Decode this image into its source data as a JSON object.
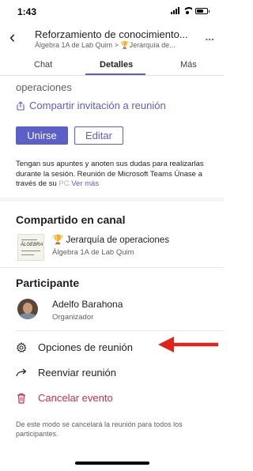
{
  "status_bar": {
    "time": "1:43"
  },
  "header": {
    "title": "Reforzamiento de conocimiento...",
    "subtitle_course": "Álgebra 1A de Lab Quim",
    "subtitle_sep": " > ",
    "subtitle_channel": "Jerarquía de...",
    "more_label": "..."
  },
  "tabs": [
    {
      "label": "Chat"
    },
    {
      "label": "Detalles"
    },
    {
      "label": "Más"
    }
  ],
  "details": {
    "operations_text": "operaciones",
    "share_label": "Compartir invitación a reunión",
    "join_label": "Unirse",
    "edit_label": "Editar",
    "description_main": "Tengan sus apuntes y anoten sus dudas para realizarlas durante la sesión. Reunión de Microsoft Teams Únase a través de su ",
    "description_fade": "PC",
    "see_more": "Ver más"
  },
  "shared": {
    "heading": "Compartido en canal",
    "thumb_text": "ÁLGEBRA",
    "channel_name": "Jerarquía de operaciones",
    "course_name": "Álgebra 1A de Lab Quim"
  },
  "participant": {
    "heading": "Participante",
    "name": "Adelfo Barahona",
    "role": "Organizador"
  },
  "actions": {
    "options": "Opciones de reunión",
    "forward": "Reenviar reunión",
    "cancel": "Cancelar evento"
  },
  "footer_note": "De este modo se cancelará la reunión para todos los participantes.",
  "colors": {
    "accent": "#5b5fc7",
    "danger": "#c4314b",
    "arrow": "#e0231b",
    "trophy": "#d4a017"
  }
}
